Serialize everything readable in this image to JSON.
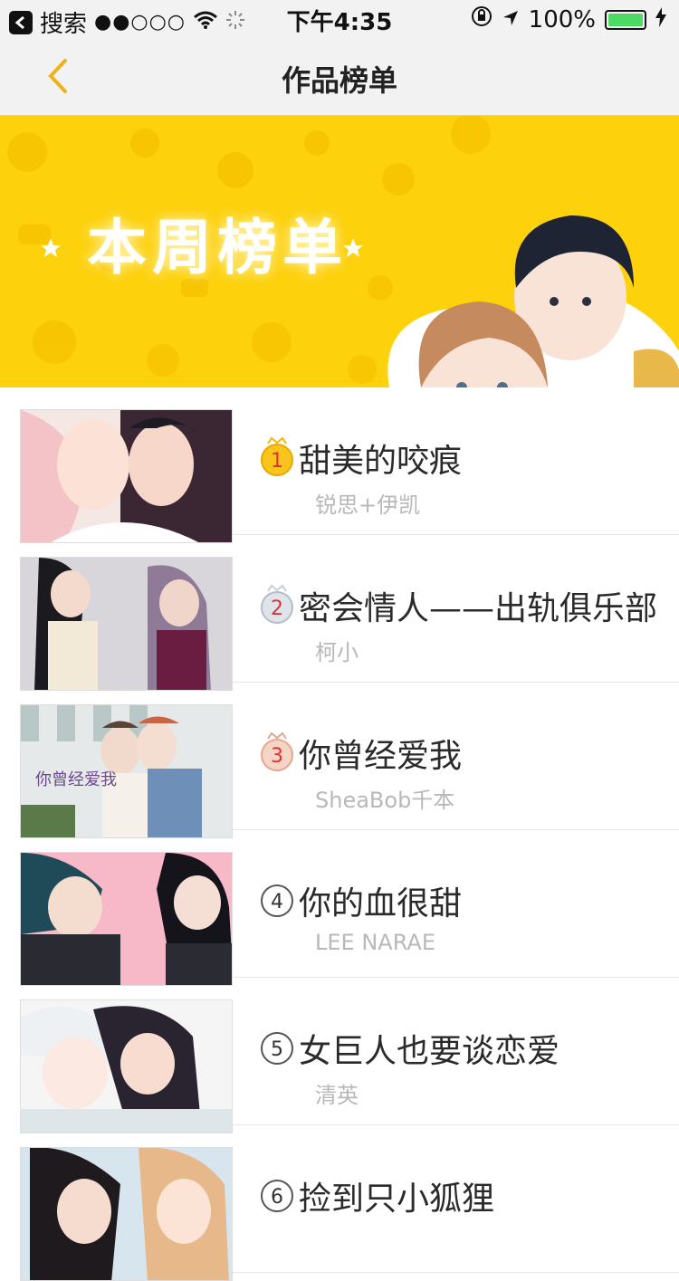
{
  "status_bar": {
    "back_app": "搜索",
    "signal": "●●○○○",
    "time": "下午4:35",
    "battery": "100%"
  },
  "nav": {
    "title": "作品榜单"
  },
  "banner": {
    "title": "本周榜单"
  },
  "items": [
    {
      "rank": "1",
      "title": "甜美的咬痕",
      "author": "锐思+伊凯",
      "rank_color": "#f7c51c"
    },
    {
      "rank": "2",
      "title": "密会情人——出轨俱乐部",
      "author": "柯小",
      "rank_color": "#dfe3ea"
    },
    {
      "rank": "3",
      "title": "你曾经爱我",
      "author": "SheaBob千本",
      "rank_color": "#f6d4c6"
    },
    {
      "rank": "4",
      "title": "你的血很甜",
      "author": "LEE NARAE"
    },
    {
      "rank": "5",
      "title": "女巨人也要谈恋爱",
      "author": "清英"
    },
    {
      "rank": "6",
      "title": "捡到只小狐狸",
      "author": ""
    }
  ],
  "thumb_caption_3": "你曾经爱我"
}
